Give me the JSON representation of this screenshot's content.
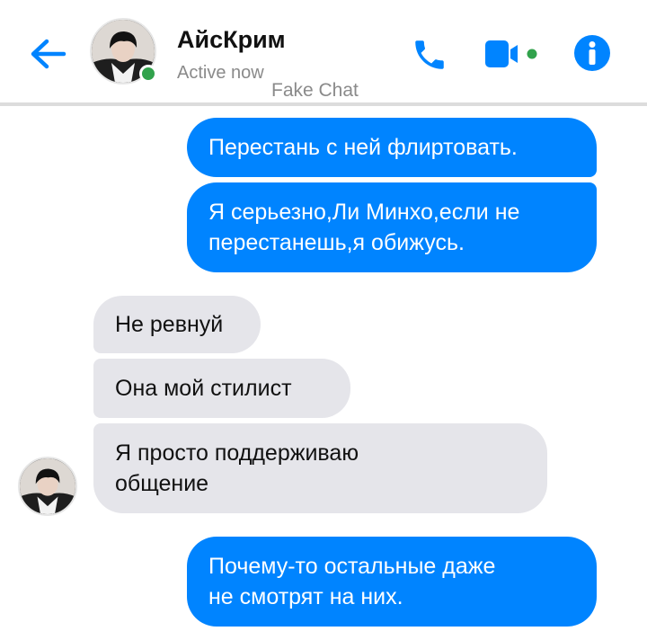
{
  "header": {
    "contact_name": "АйсКрим",
    "status": "Active now",
    "watermark": "Fake Chat",
    "back_icon": "arrow-left-icon",
    "call_icon": "phone-icon",
    "video_icon": "video-camera-icon",
    "info_icon": "info-icon"
  },
  "colors": {
    "accent": "#0084ff",
    "incoming_bubble": "#e5e5ea",
    "online": "#31a24c"
  },
  "messages": [
    {
      "side": "outgoing",
      "lines": [
        "Перестань с ней флиртовать."
      ]
    },
    {
      "side": "outgoing",
      "lines": [
        "Я серьезно,Ли Минхо,если не",
        "перестанешь,я обижусь."
      ]
    },
    {
      "side": "incoming",
      "lines": [
        "Не ревнуй"
      ]
    },
    {
      "side": "incoming",
      "lines": [
        "Она мой стилист"
      ]
    },
    {
      "side": "incoming",
      "lines": [
        "Я просто поддерживаю",
        "общение"
      ]
    },
    {
      "side": "outgoing",
      "lines": [
        "Почему-то остальные даже",
        "не смотрят на них."
      ]
    }
  ]
}
